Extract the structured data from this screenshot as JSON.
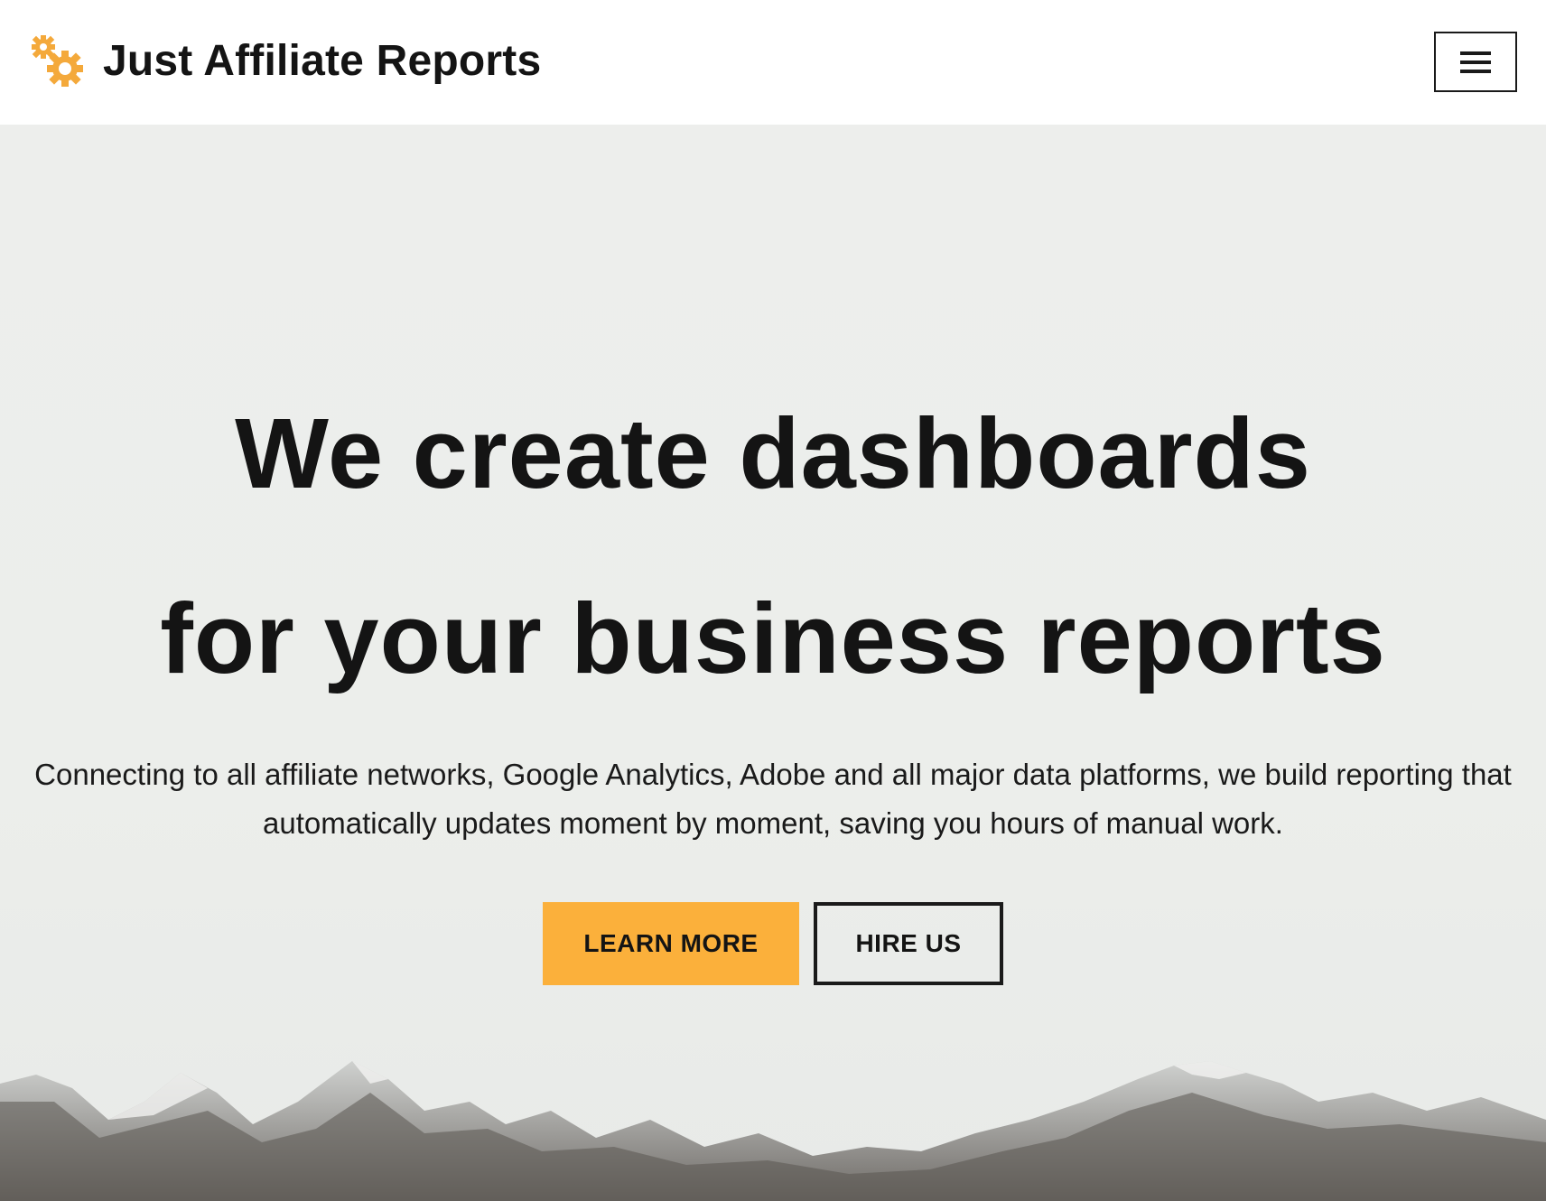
{
  "header": {
    "site_title": "Just Affiliate Reports",
    "logo_icon": "gears-icon",
    "menu_icon": "hamburger-menu-icon"
  },
  "hero": {
    "headline_line1": "We create dashboards",
    "headline_line2": "for your business reports",
    "subtitle_line1": "Connecting to all affiliate networks, Google Analytics, Adobe and all major data platforms, we build reporting that",
    "subtitle_line2": "automatically updates moment by moment, saving you hours of manual work.",
    "primary_button": "LEARN MORE",
    "secondary_button": "HIRE US",
    "background_image": "snowy-mountains"
  },
  "colors": {
    "accent": "#fbb03b",
    "text": "#141414",
    "hero_background": "#edeeec"
  }
}
